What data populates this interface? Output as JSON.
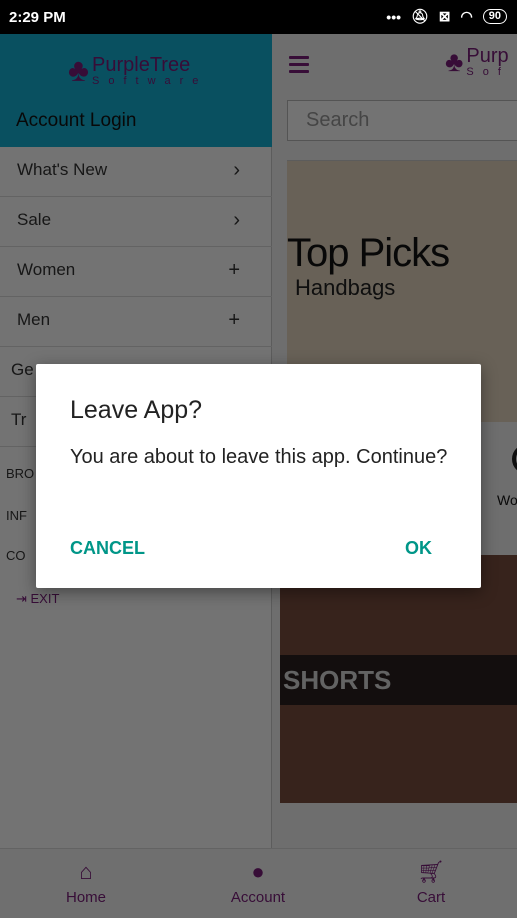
{
  "status_bar": {
    "time": "2:29 PM",
    "battery": "90",
    "icons": [
      "more-dots-icon",
      "bell-off-icon",
      "sim-x-icon",
      "wifi-icon",
      "battery-icon"
    ]
  },
  "drawer": {
    "logo_title": "PurpleTree",
    "logo_sub": "Software",
    "account_login": "Account Login",
    "menu": [
      {
        "label": "What's New",
        "action": "›"
      },
      {
        "label": "Sale",
        "action": "›"
      },
      {
        "label": "Women",
        "action": "+"
      },
      {
        "label": "Men",
        "action": "+"
      },
      {
        "label": "Ge"
      },
      {
        "label": "Tr"
      }
    ],
    "small_links": [
      "BRO",
      "INF",
      "CO"
    ],
    "exit_label": "EXIT"
  },
  "main": {
    "logo_title": "Purp",
    "logo_sub": "Sof",
    "search_placeholder": "Search",
    "banner_title": "Top Picks",
    "banner_sub": "Handbags",
    "category_partial": "Wo",
    "shorts_label": "SHORTS"
  },
  "bottom_nav": [
    {
      "label": "Home",
      "icon": "home-icon"
    },
    {
      "label": "Account",
      "icon": "account-icon"
    },
    {
      "label": "Cart",
      "icon": "cart-icon"
    }
  ],
  "dialog": {
    "title": "Leave App?",
    "body": "You are about to leave this app. Continue?",
    "cancel": "CANCEL",
    "ok": "OK"
  },
  "colors": {
    "accent": "#7b1c7b",
    "drawer_header": "#14b2d6",
    "dialog_button": "#009688"
  }
}
